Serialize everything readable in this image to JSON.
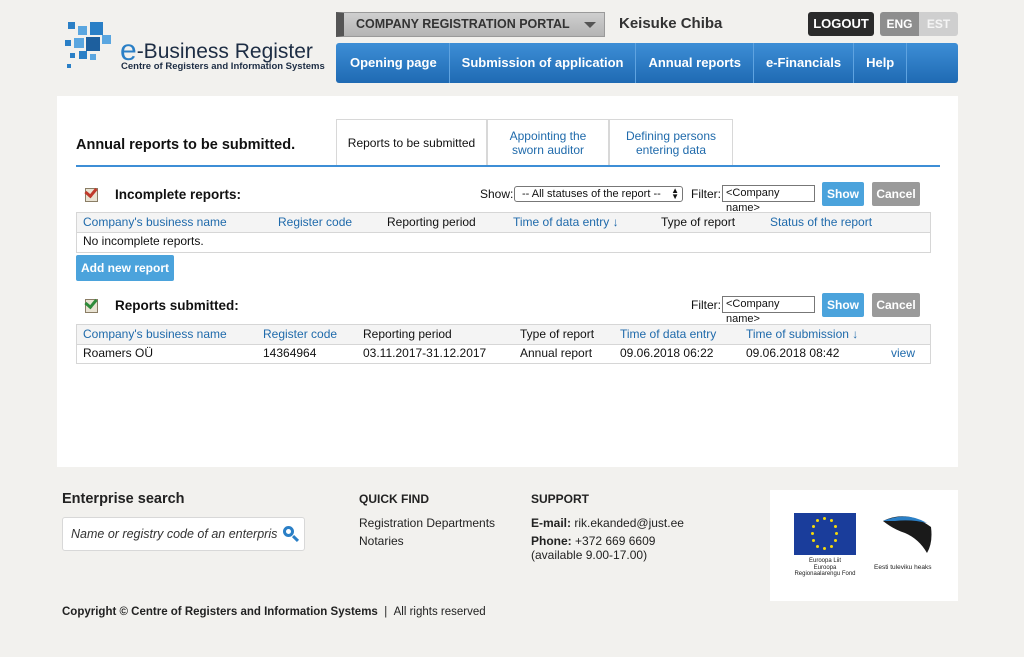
{
  "logo": {
    "title": "-Business Register",
    "title_e": "e",
    "subtitle": "Centre of Registers and Information Systems"
  },
  "header": {
    "portal_select": "COMPANY REGISTRATION PORTAL",
    "user_name": "Keisuke Chiba",
    "logout": "LOGOUT",
    "lang_eng": "ENG",
    "lang_est": "EST"
  },
  "nav": {
    "items": [
      "Opening page",
      "Submission of application",
      "Annual reports",
      "e-Financials",
      "Help"
    ]
  },
  "page": {
    "title": "Annual reports to be submitted.",
    "tabs": [
      {
        "label": "Reports to be submitted"
      },
      {
        "label_line1": "Appointing the",
        "label_line2": "sworn auditor"
      },
      {
        "label_line1": "Defining persons",
        "label_line2": "entering data"
      }
    ]
  },
  "incomplete": {
    "title": "Incomplete reports:",
    "show_label": "Show:",
    "status_select": "-- All statuses of the report --",
    "filter_label": "Filter:",
    "filter_value": "<Company name>",
    "show_button": "Show",
    "cancel_button": "Cancel",
    "columns": [
      "Company's business name",
      "Register code",
      "Reporting period",
      "Time of data entry ↓",
      "Type of report",
      "Status of the report"
    ],
    "empty_text": "No incomplete reports.",
    "add_button": "Add new report"
  },
  "submitted": {
    "title": "Reports submitted:",
    "filter_label": "Filter:",
    "filter_value": "<Company name>",
    "show_button": "Show",
    "cancel_button": "Cancel",
    "columns": [
      "Company's business name",
      "Register code",
      "Reporting period",
      "Type of report",
      "Time of data entry",
      "Time of submission ↓"
    ],
    "rows": [
      {
        "name": "Roamers OÜ",
        "code": "14364964",
        "period": "03.11.2017-31.12.2017",
        "type": "Annual report",
        "entry": "09.06.2018 06:22",
        "submission": "09.06.2018 08:42",
        "action": "view"
      }
    ]
  },
  "footer": {
    "search_title": "Enterprise search",
    "search_placeholder": "Name or registry code of an enterprise",
    "quick_find_title": "QUICK FIND",
    "quick_links": [
      "Registration Departments",
      "Notaries"
    ],
    "support_title": "SUPPORT",
    "email_label": "E-mail:",
    "email": "rik.ekanded@just.ee",
    "phone_label": "Phone:",
    "phone": "+372 669 6609",
    "availability": "(available 9.00-17.00)",
    "eu_caption_1": "Euroopa Liit",
    "eu_caption_2": "Euroopa",
    "eu_caption_3": "Regionaalarengu Fond",
    "est_caption": "Eesti tuleviku heaks",
    "copyright_bold": "Copyright © Centre of Registers and Information Systems",
    "copyright_sep": "|",
    "copyright_rest": "All rights reserved"
  },
  "colors": {
    "accent": "#2a7fc6",
    "nav_bg": "#2a7fc6",
    "button_blue": "#4ba3dc",
    "button_grey": "#9a9a9a",
    "page_bg": "#f2f1ee"
  }
}
